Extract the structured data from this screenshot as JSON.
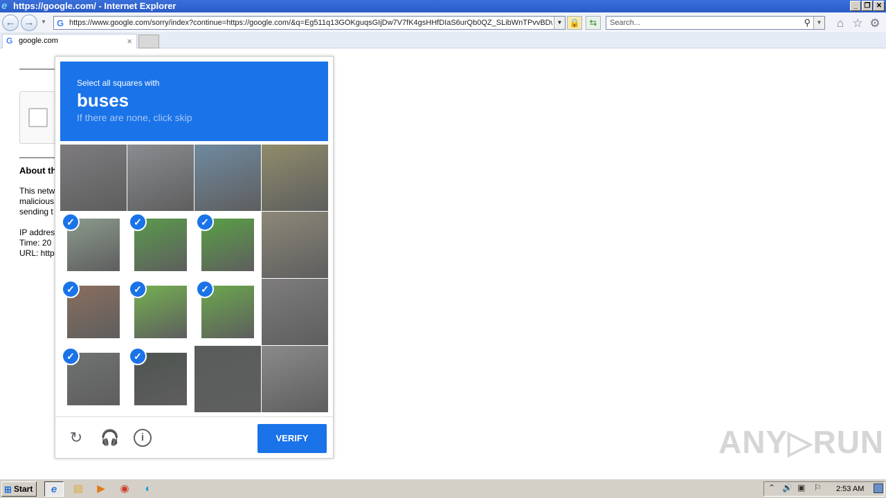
{
  "window": {
    "title": "https://google.com/ - Internet Explorer",
    "controls": {
      "minimize": "_",
      "restore": "❐",
      "close": "✕"
    }
  },
  "navbar": {
    "url": "https://www.google.com/sorry/index?continue=https://google.com/&q=Eg511q13GOKguqsGIjDw7V7fK4gsHHfDIaS6urQb0QZ_SLibWnTPvvBDwE",
    "search_placeholder": "Search..."
  },
  "tabs": [
    {
      "label": "google.com"
    }
  ],
  "page": {
    "about_heading": "About th",
    "paragraph_lines": [
      "This netw",
      "malicious",
      "sending t"
    ],
    "ip_line": "IP addres",
    "time_line": "Time: 20",
    "url_line": "URL: http"
  },
  "captcha": {
    "instruction": "Select all squares with",
    "target": "buses",
    "hint": "If there are none, click skip",
    "verify_label": "VERIFY",
    "tiles": [
      {
        "selected": false,
        "color": "#7d7b7e"
      },
      {
        "selected": false,
        "color": "#8a8c90"
      },
      {
        "selected": false,
        "color": "#6f8aa0"
      },
      {
        "selected": false,
        "color": "#8f8c6a"
      },
      {
        "selected": true,
        "color": "#8b9a8c"
      },
      {
        "selected": true,
        "color": "#5a9a4c"
      },
      {
        "selected": true,
        "color": "#5aa046"
      },
      {
        "selected": false,
        "color": "#8c8878"
      },
      {
        "selected": true,
        "color": "#8a6e5e"
      },
      {
        "selected": true,
        "color": "#74b050"
      },
      {
        "selected": true,
        "color": "#6aa84c"
      },
      {
        "selected": false,
        "color": "#7e7c7c"
      },
      {
        "selected": true,
        "color": "#6f7370"
      },
      {
        "selected": true,
        "color": "#4e5450"
      },
      {
        "selected": false,
        "color": "#5a5c5c"
      },
      {
        "selected": false,
        "color": "#8a8a8a"
      }
    ]
  },
  "watermark": "ANY▷RUN",
  "taskbar": {
    "start_label": "Start",
    "clock": "2:53 AM"
  }
}
